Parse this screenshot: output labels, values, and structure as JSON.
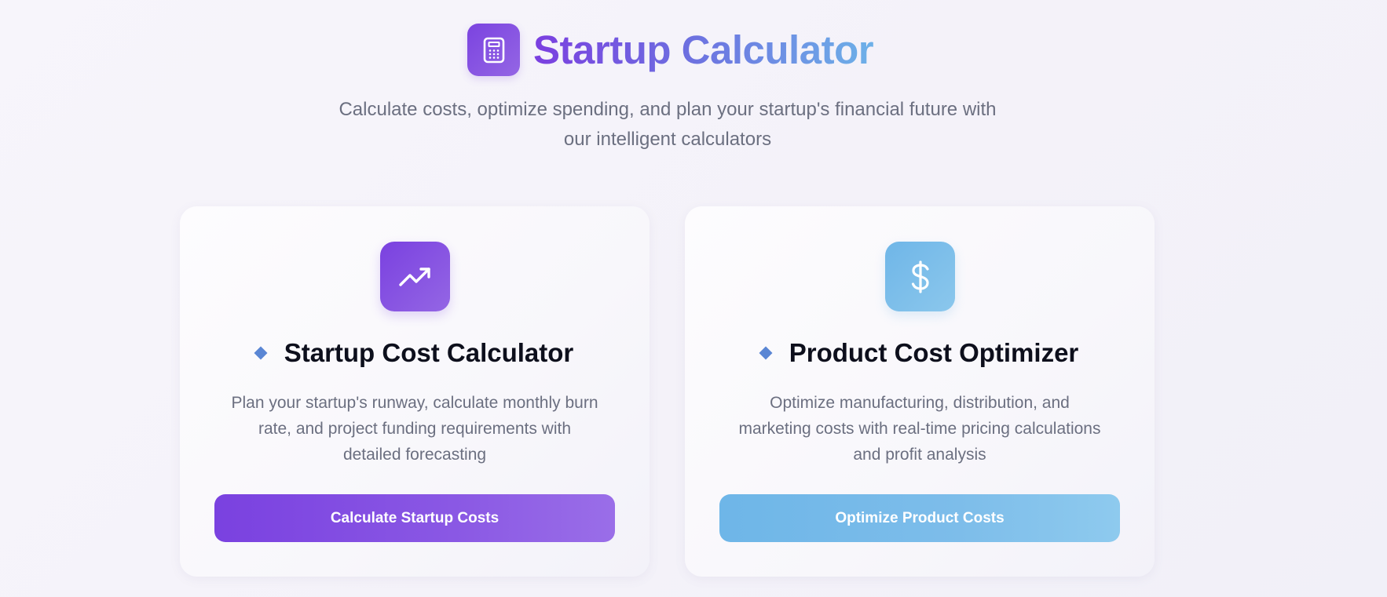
{
  "header": {
    "title": "Startup Calculator",
    "subtitle_line1": "Calculate costs, optimize spending, and plan your startup's financial future with",
    "subtitle_line2": "our intelligent calculators",
    "logo_icon": "calculator-icon"
  },
  "cards": [
    {
      "icon": "trending-up-icon",
      "title": "Startup Cost Calculator",
      "desc_line1": "Plan your startup's runway, calculate monthly burn",
      "desc_line2": "rate, and project funding requirements with",
      "desc_line3": "detailed forecasting",
      "button_label": "Calculate Startup Costs",
      "accent": "#7a41e0"
    },
    {
      "icon": "dollar-icon",
      "title": "Product Cost Optimizer",
      "desc_line1": "Optimize manufacturing, distribution, and",
      "desc_line2": "marketing costs with real-time pricing calculations",
      "desc_line3": "and profit analysis",
      "button_label": "Optimize Product Costs",
      "accent": "#6eb6e8"
    }
  ],
  "colors": {
    "title_gradient_start": "#7b3fe0",
    "title_gradient_end": "#6db1e8",
    "diamond": "#5a86d4",
    "text_muted": "#6b6f80"
  }
}
